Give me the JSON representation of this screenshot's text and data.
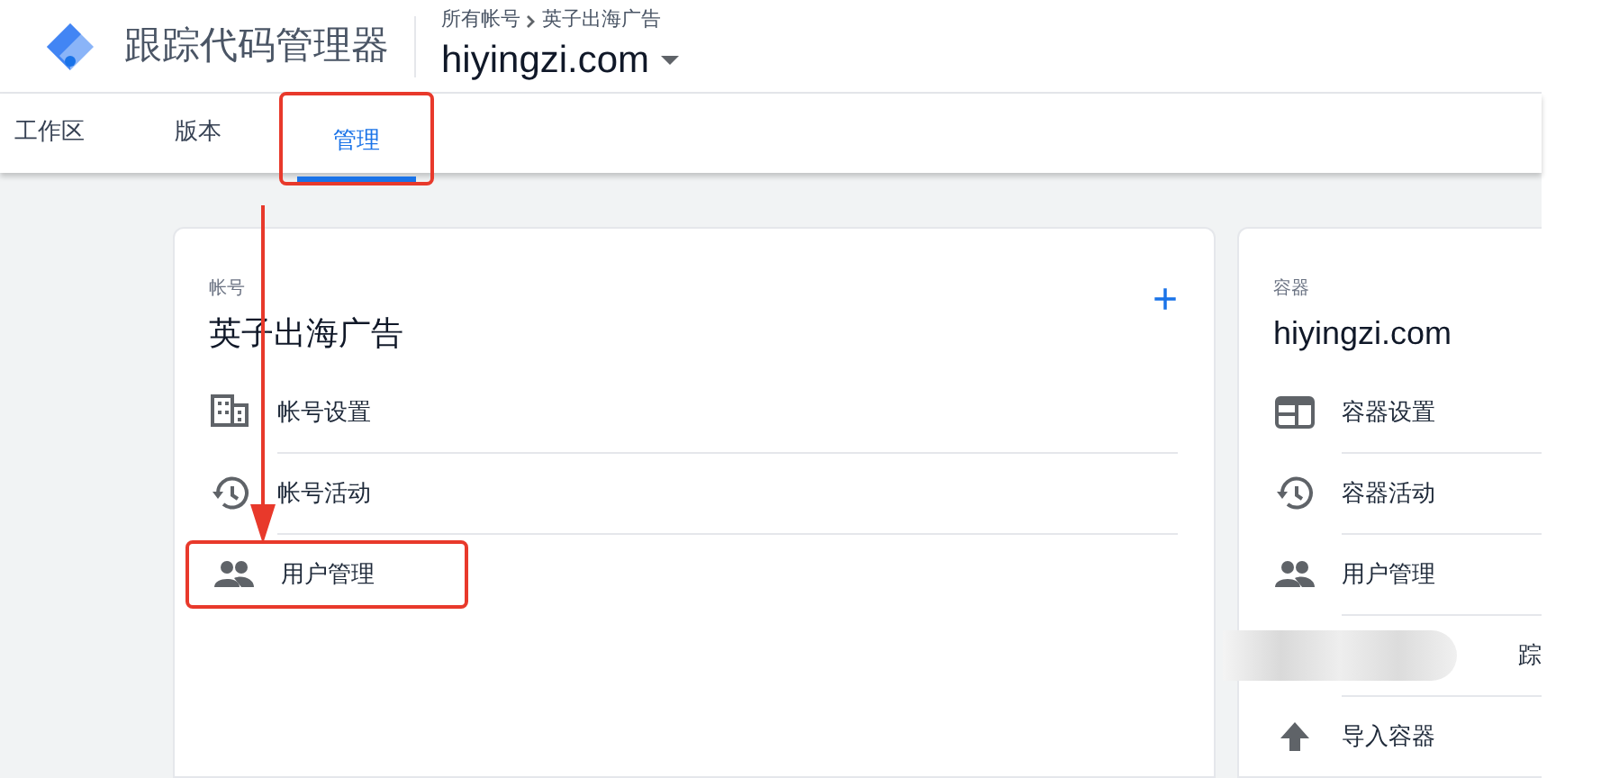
{
  "header": {
    "product": "跟踪代码管理器",
    "breadcrumb": [
      "所有帐号",
      "英子出海广告"
    ],
    "container": "hiyingzi.com"
  },
  "tabs": [
    {
      "label": "工作区",
      "selected": false,
      "annotated": false
    },
    {
      "label": "版本",
      "selected": false,
      "annotated": false
    },
    {
      "label": "管理",
      "selected": true,
      "annotated": true
    }
  ],
  "account": {
    "label": "帐号",
    "title": "英子出海广告",
    "add": "+",
    "items": [
      {
        "kind": "building",
        "label": "帐号设置",
        "annotated": false
      },
      {
        "kind": "history",
        "label": "帐号活动",
        "annotated": false
      },
      {
        "kind": "people",
        "label": "用户管理",
        "annotated": true
      }
    ]
  },
  "container": {
    "label": "容器",
    "title": "hiyingzi.com",
    "items": [
      {
        "kind": "window",
        "label": "容器设置",
        "redacted": false
      },
      {
        "kind": "history",
        "label": "容器活动",
        "redacted": false
      },
      {
        "kind": "people",
        "label": "用户管理",
        "redacted": false
      },
      {
        "kind": "redacted",
        "label": "踪",
        "redacted": true
      },
      {
        "kind": "upload",
        "label": "导入容器",
        "redacted": false
      }
    ]
  }
}
